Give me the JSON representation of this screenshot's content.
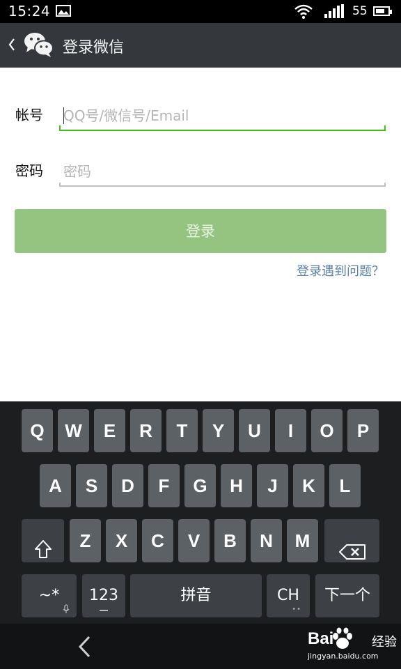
{
  "status_bar": {
    "time": "15:24",
    "battery_level": "55",
    "icons": [
      "gallery-icon",
      "wifi-icon",
      "signal-icon",
      "battery-icon"
    ]
  },
  "header": {
    "title": "登录微信",
    "icons": [
      "back-chevron-icon",
      "wechat-logo-icon"
    ]
  },
  "form": {
    "account_label": "帐号",
    "account_placeholder": "QQ号/微信号/Email",
    "account_value": "",
    "password_label": "密码",
    "password_placeholder": "密码",
    "password_value": "",
    "login_button": "登录",
    "help_link": "登录遇到问题？"
  },
  "keyboard": {
    "row1": [
      "Q",
      "W",
      "E",
      "R",
      "T",
      "Y",
      "U",
      "I",
      "O",
      "P"
    ],
    "row2": [
      "A",
      "S",
      "D",
      "F",
      "G",
      "H",
      "J",
      "K",
      "L"
    ],
    "row3": [
      "Z",
      "X",
      "C",
      "V",
      "B",
      "N",
      "M"
    ],
    "symbols_key": "~*",
    "numbers_key": "123",
    "space_key": "拼音",
    "language_key": "CH",
    "next_key": "下一个",
    "icons": [
      "shift-icon",
      "backspace-icon",
      "microphone-icon"
    ]
  },
  "navigation": {
    "icons": [
      "nav-back-icon"
    ]
  },
  "watermark": {
    "brand": "Bai",
    "suffix": "经验",
    "url": "jingyan.baidu.com"
  },
  "colors": {
    "accent_green": "#45c01a",
    "button_green": "#94c47f",
    "link_blue": "#5a80a8",
    "titlebar": "#34383d",
    "key": "#5c6166",
    "keyboard_bg": "#1d1e20"
  }
}
